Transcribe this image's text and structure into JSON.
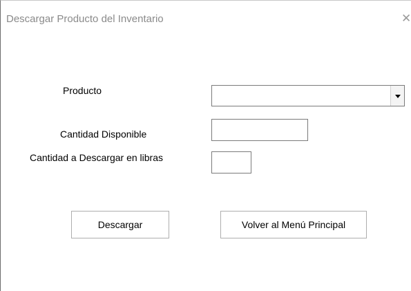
{
  "window": {
    "title": "Descargar Producto del Inventario",
    "close_icon": "close-icon"
  },
  "form": {
    "producto_label": "Producto",
    "producto_value": "",
    "cantidad_disponible_label": "Cantidad Disponible",
    "cantidad_disponible_value": "",
    "cantidad_descargar_label": "Cantidad a Descargar en libras",
    "cantidad_descargar_value": ""
  },
  "buttons": {
    "descargar_label": "Descargar",
    "volver_label": "Volver al Menú Principal"
  }
}
